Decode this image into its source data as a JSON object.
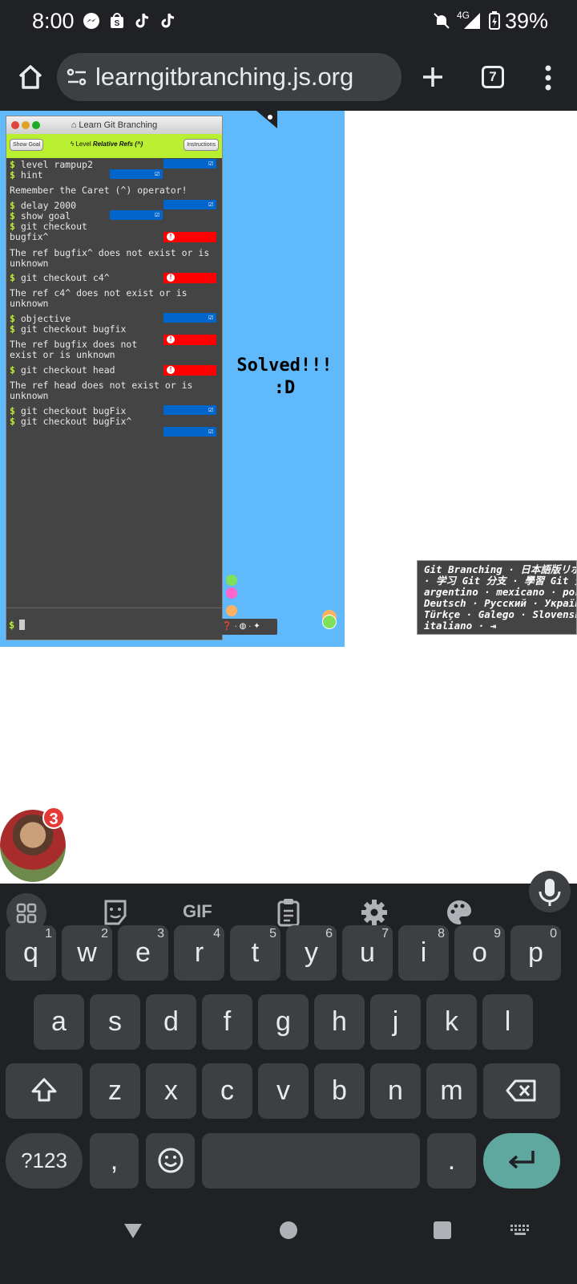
{
  "status_bar": {
    "time": "8:00",
    "icons": [
      "messenger-icon",
      "shop-icon",
      "tiktok-icon",
      "tiktok-icon",
      "mute-icon",
      "signal-icon",
      "battery-icon"
    ],
    "network": "4G",
    "battery": "39%"
  },
  "browser": {
    "url": "learngitbranching.js.org",
    "tab_count": "7"
  },
  "terminal": {
    "window_title": "Learn Git Branching",
    "show_goal_label": "Show Goal",
    "level_prefix": "Level",
    "level_name": "Relative Refs (^)",
    "instructions_label": "Instructions",
    "lines": {
      "l1": "level rampup2",
      "l2": "hint",
      "l3": "Remember the Caret (^) operator!",
      "l4": "delay 2000",
      "l5": "show goal",
      "l6": "git checkout",
      "l6b": "bugfix^",
      "l7": "The ref bugfix^ does not exist or is",
      "l7b": "unknown",
      "l8": "git checkout c4^",
      "l9": "The ref c4^ does not exist or is",
      "l9b": "unknown",
      "l10": "objective",
      "l11": "git checkout bugfix",
      "l12": "The ref bugfix does not",
      "l12b": "exist or is unknown",
      "l13": "git checkout head",
      "l14": "The ref head does not exist or is",
      "l14b": "unknown",
      "l15": "git checkout bugFix",
      "l16": "git checkout bugFix^"
    },
    "prompt": "$"
  },
  "canvas": {
    "solved_line1": "Solved!!!",
    "solved_line2": ":D"
  },
  "languages": {
    "line1": "Git Branching · 日本語版リポジ",
    "line2": "· 学习 Git 分支 · 學習 Git 分支",
    "line3": "argentino · mexicano · portu",
    "line4": "Deutsch · Русский · Українсь",
    "line5": "Türkçe · Galego · Slovensko",
    "line6": "italiano · ⇥"
  },
  "avatar": {
    "badge_count": "3"
  },
  "keyboard": {
    "row1": [
      {
        "k": "q",
        "h": "1"
      },
      {
        "k": "w",
        "h": "2"
      },
      {
        "k": "e",
        "h": "3"
      },
      {
        "k": "r",
        "h": "4"
      },
      {
        "k": "t",
        "h": "5"
      },
      {
        "k": "y",
        "h": "6"
      },
      {
        "k": "u",
        "h": "7"
      },
      {
        "k": "i",
        "h": "8"
      },
      {
        "k": "o",
        "h": "9"
      },
      {
        "k": "p",
        "h": "0"
      }
    ],
    "row2": [
      "a",
      "s",
      "d",
      "f",
      "g",
      "h",
      "j",
      "k",
      "l"
    ],
    "row3": [
      "z",
      "x",
      "c",
      "v",
      "b",
      "n",
      "m"
    ],
    "symbols_label": "?123",
    "comma": ",",
    "period": ".",
    "gif_label": "GIF"
  }
}
